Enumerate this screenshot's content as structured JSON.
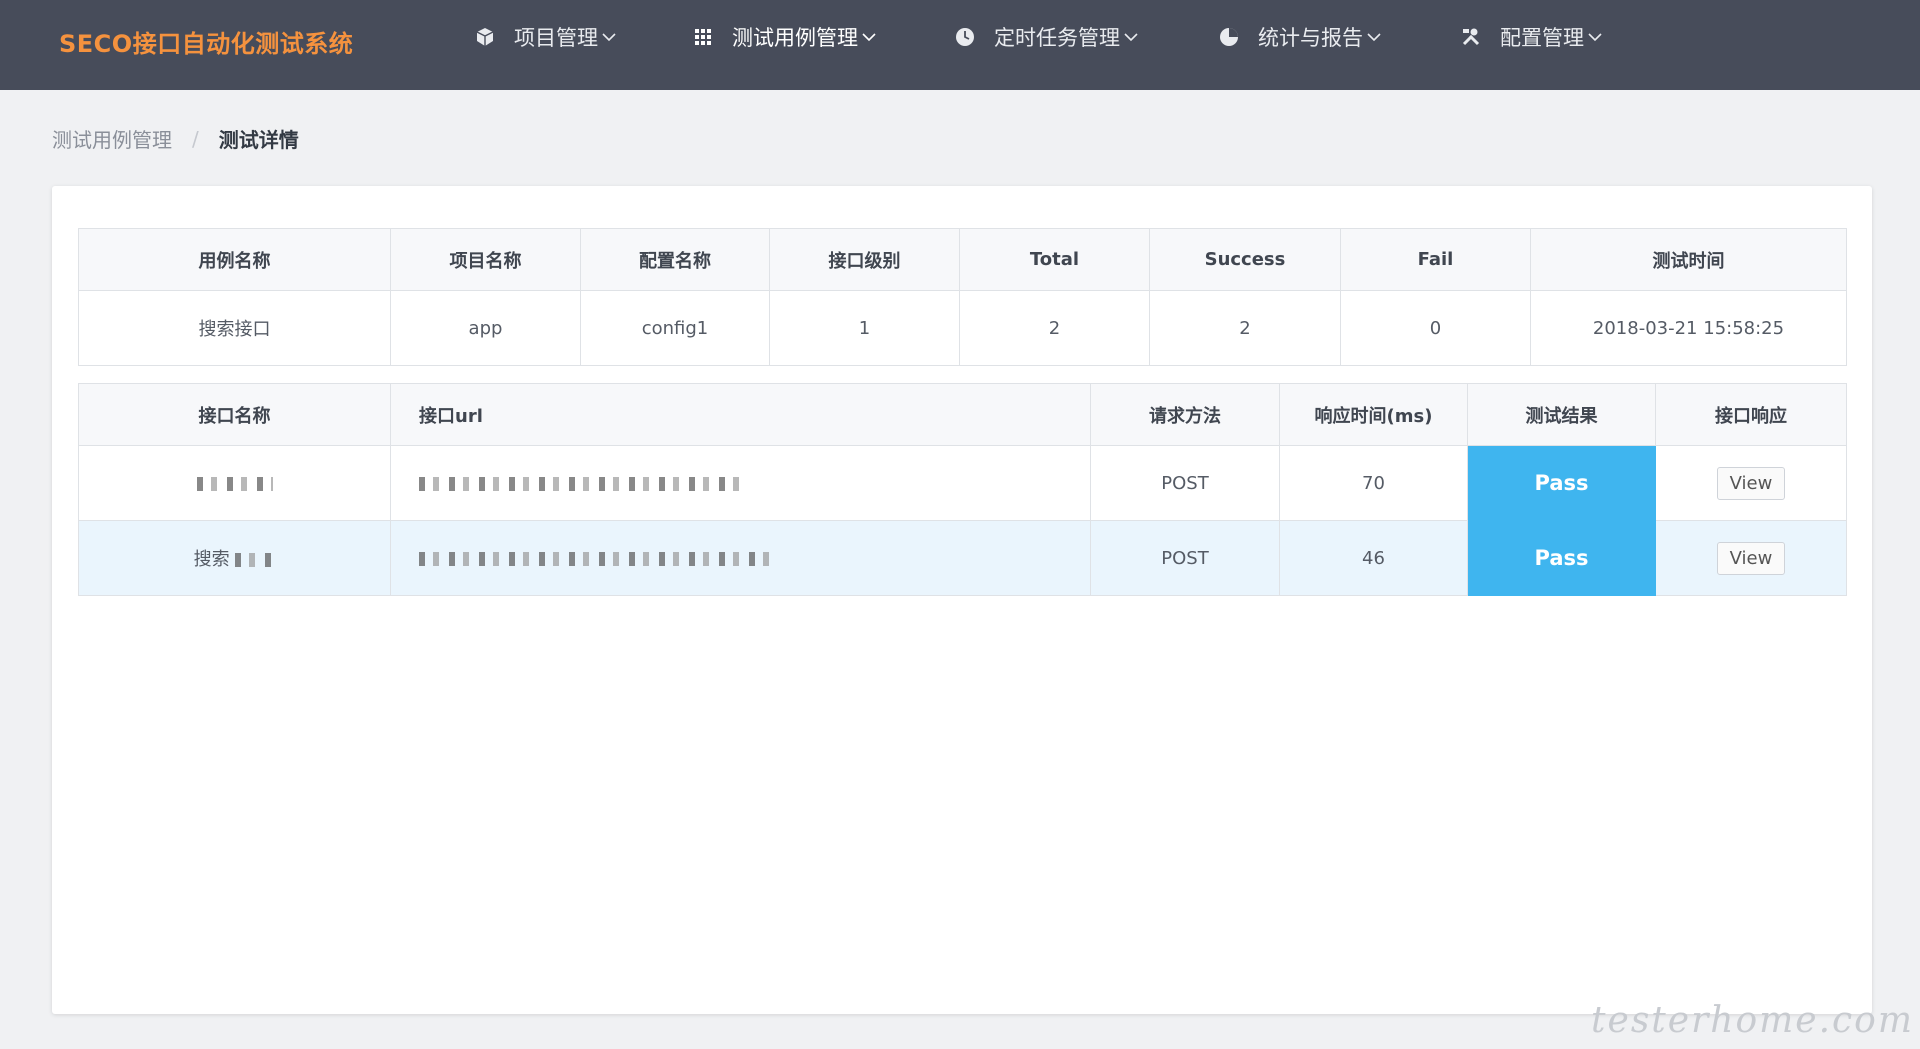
{
  "app": {
    "brand": "SECO接口自动化测试系统"
  },
  "nav": [
    {
      "label": "项目管理",
      "icon": "cube-icon"
    },
    {
      "label": "测试用例管理",
      "icon": "grid-icon",
      "active": true
    },
    {
      "label": "定时任务管理",
      "icon": "clock-icon"
    },
    {
      "label": "统计与报告",
      "icon": "pie-chart-icon"
    },
    {
      "label": "配置管理",
      "icon": "tools-icon"
    }
  ],
  "breadcrumb": {
    "parent": "测试用例管理",
    "separator": "/",
    "current": "测试详情"
  },
  "summary": {
    "headers": [
      "用例名称",
      "项目名称",
      "配置名称",
      "接口级别",
      "Total",
      "Success",
      "Fail",
      "测试时间"
    ],
    "row": [
      "搜索接口",
      "app",
      "config1",
      "1",
      "2",
      "2",
      "0",
      "2018-03-21 15:58:25"
    ]
  },
  "details": {
    "headers": [
      "接口名称",
      "接口url",
      "请求方法",
      "响应时间(ms)",
      "测试结果",
      "接口响应"
    ],
    "rows": [
      {
        "name": "",
        "url": "",
        "method": "POST",
        "time": "70",
        "result": "Pass",
        "action": "View"
      },
      {
        "name": "搜索",
        "url": "",
        "method": "POST",
        "time": "46",
        "result": "Pass",
        "action": "View"
      }
    ]
  },
  "colors": {
    "topbar": "#474c5a",
    "brand": "#f5923e",
    "pass": "#3fb5ef",
    "alt_row": "#eaf5fd"
  },
  "watermark": "testerhome.com"
}
